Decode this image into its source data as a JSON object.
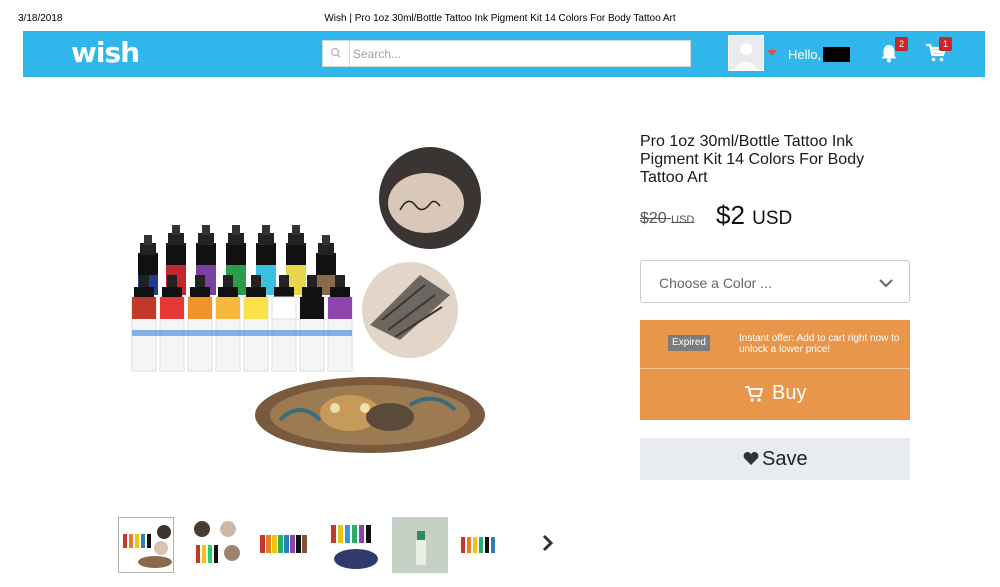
{
  "print_header": {
    "date": "3/18/2018",
    "title": "Wish | Pro 1oz 30ml/Bottle Tattoo Ink Pigment Kit 14 Colors For Body Tattoo Art"
  },
  "header": {
    "logo": "wish",
    "search_placeholder": "Search...",
    "greeting": "Hello,",
    "notification_count": "2",
    "cart_count": "1",
    "colors": {
      "bar": "#2fb7ec",
      "badge": "#c62828"
    }
  },
  "product": {
    "title": "Pro 1oz 30ml/Bottle Tattoo Ink Pigment Kit 14 Colors For Body Tattoo Art",
    "old_price": "$20",
    "old_price_currency": "USD",
    "price": "$2",
    "price_currency": "USD",
    "color_select_placeholder": "Choose a Color ...",
    "offer_badge": "Expired",
    "offer_text": "Instant offer: Add to cart right now to unlock a lower price!",
    "buy_label": "Buy",
    "save_label": "Save",
    "colors": {
      "offer": "#e8964a",
      "save_bg": "#e8ecf0"
    }
  },
  "icons": [
    "search-icon",
    "user-avatar-icon",
    "bell-icon",
    "cart-icon",
    "chevron-down-icon",
    "heart-icon",
    "chevron-right-icon"
  ]
}
